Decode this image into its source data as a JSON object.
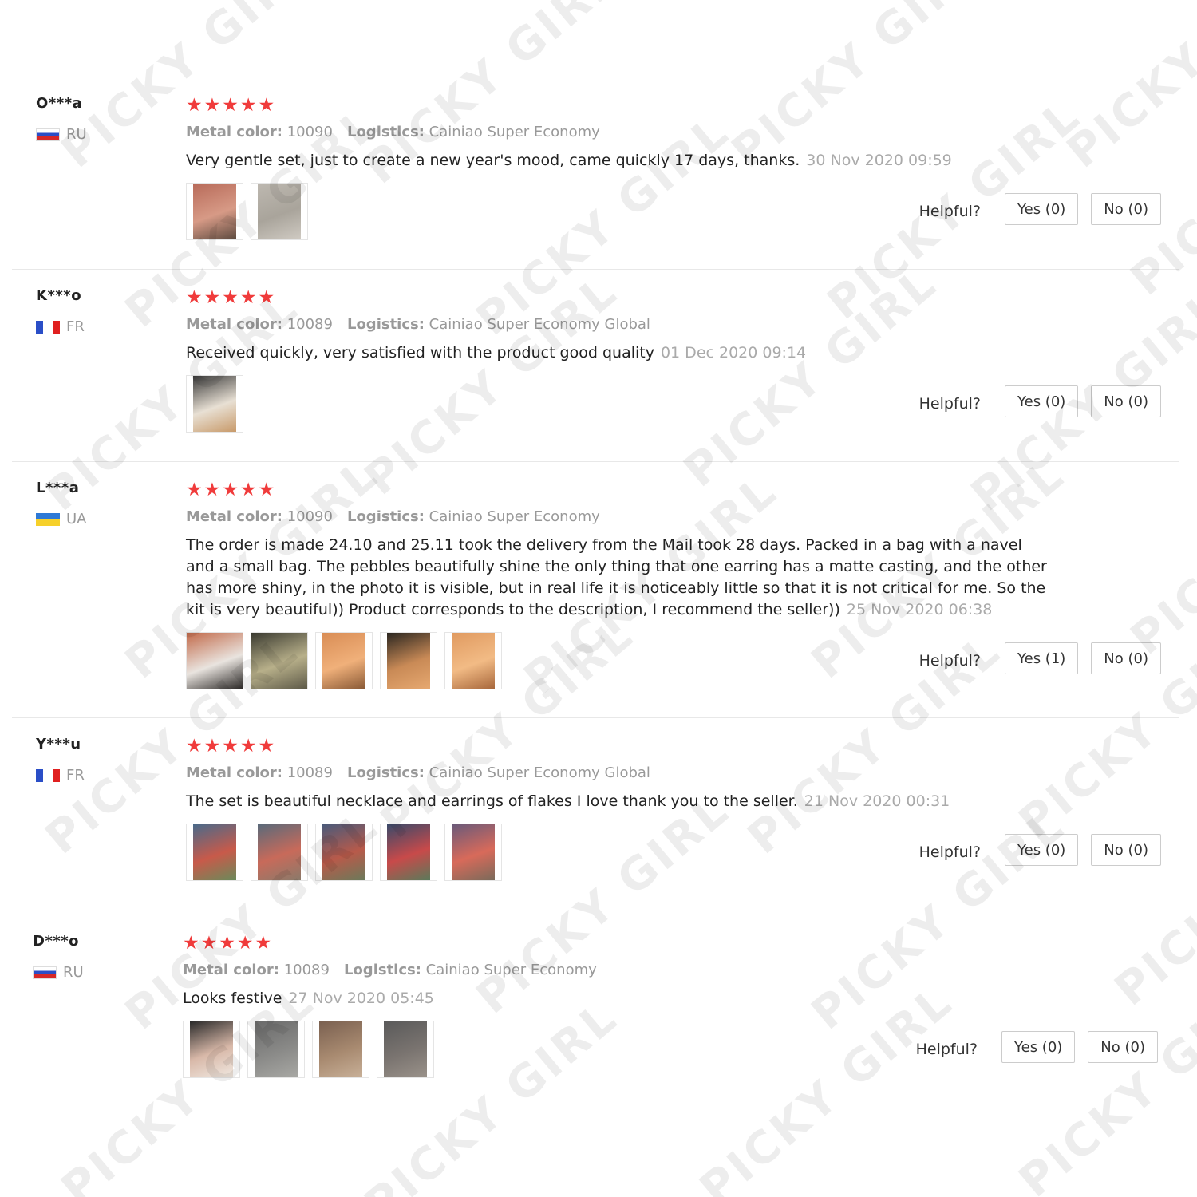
{
  "reviews": [
    {
      "user": "O***a",
      "country": "RU",
      "flag": "ru",
      "stars": 5,
      "meta": [
        {
          "key": "Metal color:",
          "value": "10090"
        },
        {
          "key": "Logistics:",
          "value": "Cainiao Super Economy"
        }
      ],
      "text": "Very gentle set, just to create a new year's mood, came quickly 17 days, thanks.",
      "date": "30 Nov 2020 09:59",
      "photos": [
        {
          "colors": [
            "#b86b5a",
            "#d79a86",
            "#5d4a3f"
          ]
        },
        {
          "colors": [
            "#bdb8b0",
            "#a9a49b",
            "#cfcac2"
          ]
        }
      ],
      "helpful_label": "Helpful?",
      "yes_label": "Yes (0)",
      "no_label": "No (0)"
    },
    {
      "user": "K***o",
      "country": "FR",
      "flag": "fr",
      "stars": 5,
      "meta": [
        {
          "key": "Metal color:",
          "value": "10089"
        },
        {
          "key": "Logistics:",
          "value": "Cainiao Super Economy Global"
        }
      ],
      "text": "Received quickly, very satisfied with the product good quality",
      "date": "01 Dec 2020 09:14",
      "photos": [
        {
          "colors": [
            "#3a3a3a",
            "#e8e0d4",
            "#c89a6a"
          ]
        }
      ],
      "helpful_label": "Helpful?",
      "yes_label": "Yes (0)",
      "no_label": "No (0)"
    },
    {
      "user": "L***a",
      "country": "UA",
      "flag": "ua",
      "stars": 5,
      "meta": [
        {
          "key": "Metal color:",
          "value": "10090"
        },
        {
          "key": "Logistics:",
          "value": "Cainiao Super Economy"
        }
      ],
      "text": "The order is made 24.10 and 25.11 took the delivery from the Mail took 28 days. Packed in a bag with a navel and a small bag. The pebbles beautifully shine the only thing that one earring has a matte casting, and the other has more shiny, in the photo it is visible, but in real life it is noticeably little so that it is not critical for me. So the kit is very beautiful)) Product corresponds to the description, I recommend the seller))",
      "date": "25 Nov 2020 06:38",
      "photos": [
        {
          "colors": [
            "#c26a4a",
            "#e9e4df",
            "#2d2a28"
          ]
        },
        {
          "colors": [
            "#3a3a30",
            "#b8b08a",
            "#5e5a48"
          ]
        },
        {
          "colors": [
            "#d98d55",
            "#f0b07a",
            "#8a5a36"
          ]
        },
        {
          "colors": [
            "#2a2620",
            "#c98a56",
            "#e6a870"
          ]
        },
        {
          "colors": [
            "#e09a60",
            "#f2bb85",
            "#a8683c"
          ]
        }
      ],
      "helpful_label": "Helpful?",
      "yes_label": "Yes (1)",
      "no_label": "No (0)"
    },
    {
      "user": "Y***u",
      "country": "FR",
      "flag": "fr",
      "stars": 5,
      "meta": [
        {
          "key": "Metal color:",
          "value": "10089"
        },
        {
          "key": "Logistics:",
          "value": "Cainiao Super Economy Global"
        }
      ],
      "text": "The set is beautiful necklace and earrings of flakes I love thank you to the seller.",
      "date": "21 Nov 2020 00:31",
      "photos": [
        {
          "colors": [
            "#4a6a8a",
            "#c85a4a",
            "#6a8a5a"
          ]
        },
        {
          "colors": [
            "#5a6a7a",
            "#c86a5a",
            "#8a7a6a"
          ]
        },
        {
          "colors": [
            "#4a5a7a",
            "#b85a4a",
            "#6a7a5a"
          ]
        },
        {
          "colors": [
            "#3a4a6a",
            "#c84a4a",
            "#5a7a5a"
          ]
        },
        {
          "colors": [
            "#6a5a7a",
            "#d86a5a",
            "#7a6a5a"
          ]
        }
      ],
      "helpful_label": "Helpful?",
      "yes_label": "Yes (0)",
      "no_label": "No (0)"
    },
    {
      "user": "D***o",
      "country": "RU",
      "flag": "ru",
      "stars": 5,
      "meta": [
        {
          "key": "Metal color:",
          "value": "10089"
        },
        {
          "key": "Logistics:",
          "value": "Cainiao Super Economy"
        }
      ],
      "text": "Looks festive",
      "date": "27 Nov 2020 05:45",
      "photos": [
        {
          "colors": [
            "#2a2a2a",
            "#d8b8a8",
            "#f0e8e0"
          ]
        },
        {
          "colors": [
            "#6a6a6a",
            "#8a8a88",
            "#a8a8a4"
          ]
        },
        {
          "colors": [
            "#7a6050",
            "#a88a70",
            "#c8b098"
          ]
        },
        {
          "colors": [
            "#5a5a5a",
            "#7a7470",
            "#9a928a"
          ]
        }
      ],
      "helpful_label": "Helpful?",
      "yes_label": "Yes (0)",
      "no_label": "No (0)"
    }
  ],
  "watermark_text": "PICKY GIRL"
}
